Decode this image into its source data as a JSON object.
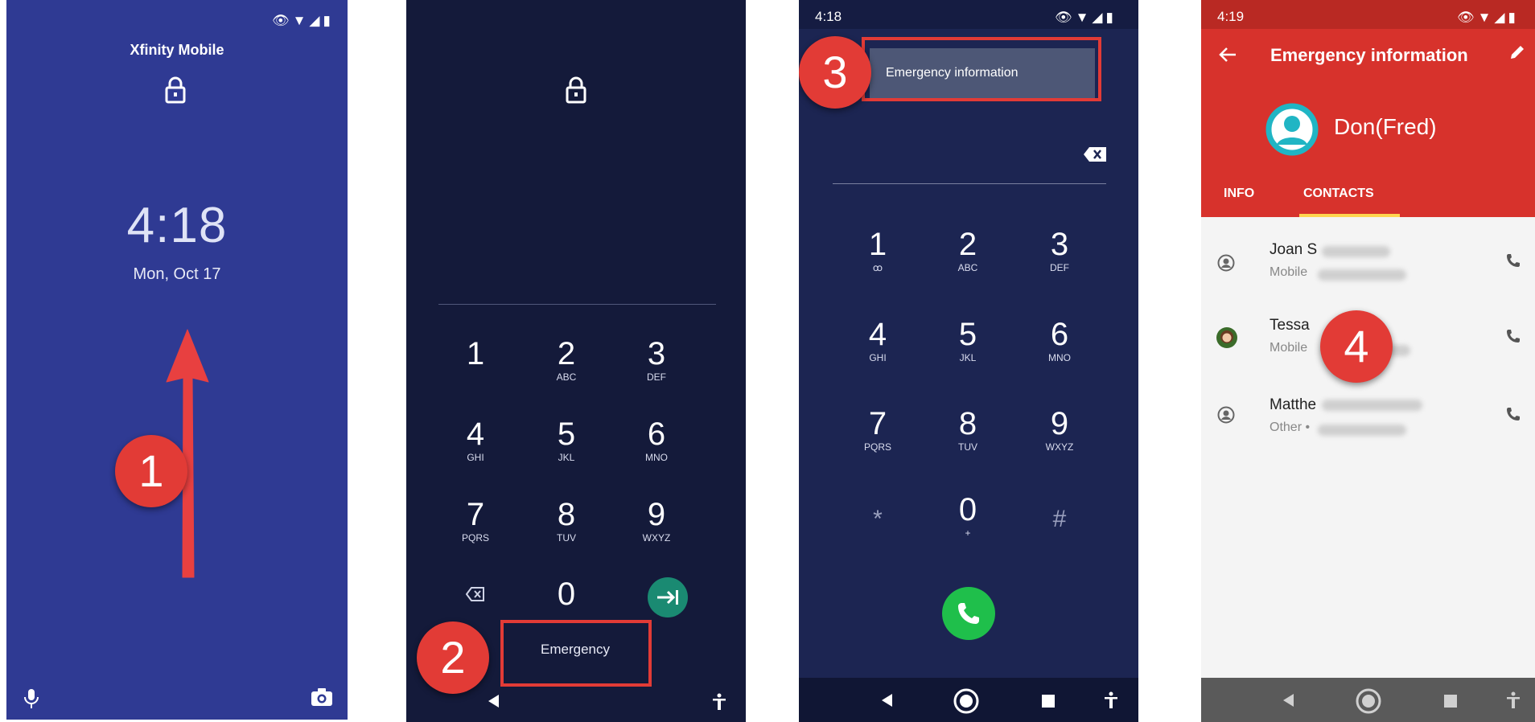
{
  "screen1": {
    "carrier": "Xfinity Mobile",
    "time": "4:18",
    "date": "Mon, Oct 17",
    "step": "1"
  },
  "screen2": {
    "keys": [
      {
        "digit": "1",
        "letters": ""
      },
      {
        "digit": "2",
        "letters": "ABC"
      },
      {
        "digit": "3",
        "letters": "DEF"
      },
      {
        "digit": "4",
        "letters": "GHI"
      },
      {
        "digit": "5",
        "letters": "JKL"
      },
      {
        "digit": "6",
        "letters": "MNO"
      },
      {
        "digit": "7",
        "letters": "PQRS"
      },
      {
        "digit": "8",
        "letters": "TUV"
      },
      {
        "digit": "9",
        "letters": "WXYZ"
      }
    ],
    "zero": "0",
    "emergency_label": "Emergency",
    "step": "2"
  },
  "screen3": {
    "status_time": "4:18",
    "emergency_info_label": "Emergency information",
    "keys": [
      {
        "digit": "1",
        "letters": "ꝏ"
      },
      {
        "digit": "2",
        "letters": "ABC"
      },
      {
        "digit": "3",
        "letters": "DEF"
      },
      {
        "digit": "4",
        "letters": "GHI"
      },
      {
        "digit": "5",
        "letters": "JKL"
      },
      {
        "digit": "6",
        "letters": "MNO"
      },
      {
        "digit": "7",
        "letters": "PQRS"
      },
      {
        "digit": "8",
        "letters": "TUV"
      },
      {
        "digit": "9",
        "letters": "WXYZ"
      },
      {
        "digit": "*",
        "letters": ""
      },
      {
        "digit": "0",
        "letters": "+"
      },
      {
        "digit": "#",
        "letters": ""
      }
    ],
    "step": "3"
  },
  "screen4": {
    "status_time": "4:19",
    "title": "Emergency information",
    "name": "Don(Fred)",
    "tabs": [
      "INFO",
      "CONTACTS"
    ],
    "contacts": [
      {
        "name": "Joan S",
        "type": "Mobile",
        "avatar": "person-icon"
      },
      {
        "name": "Tessa",
        "type": "Mobile",
        "avatar": "photo"
      },
      {
        "name": "Matthe",
        "type": "Other •",
        "avatar": "person-icon"
      }
    ],
    "step": "4"
  },
  "colors": {
    "lock_bg": "#2f3a93",
    "dialer_bg": "#141a3a",
    "emergency_dialer_bg": "#1c2552",
    "header_red": "#d7322c",
    "badge_red": "#e23b36",
    "call_green": "#1fbf4b",
    "enter_teal": "#1a8a72"
  }
}
